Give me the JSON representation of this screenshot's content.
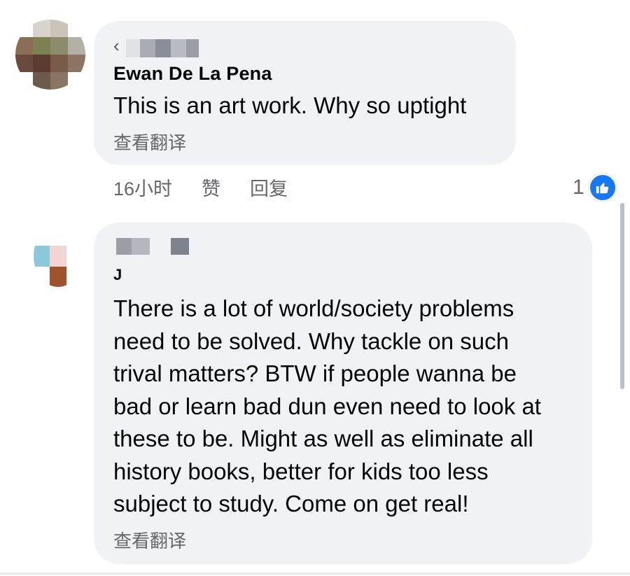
{
  "comments": [
    {
      "author": "Ewan De La Pena",
      "text": "This is an art work. Why so uptight",
      "translate_label": "查看翻译",
      "tag_glyph": "‹"
    },
    {
      "author": "J",
      "text": "There is a lot of world/society problems\nneed to be solved. Why tackle on such\ntrival matters? BTW if people wanna be\nbad or learn bad dun even need to look at\nthese to be. Might as well as eliminate all\nhistory books, better for kids too less\nsubject to study. Come on get real!",
      "translate_label": "查看翻译"
    }
  ],
  "actions": {
    "timestamp": "16小时",
    "like_label": "赞",
    "reply_label": "回复"
  },
  "reaction": {
    "count": "1",
    "icon": "thumbs-up-icon",
    "color": "#1877f2"
  }
}
